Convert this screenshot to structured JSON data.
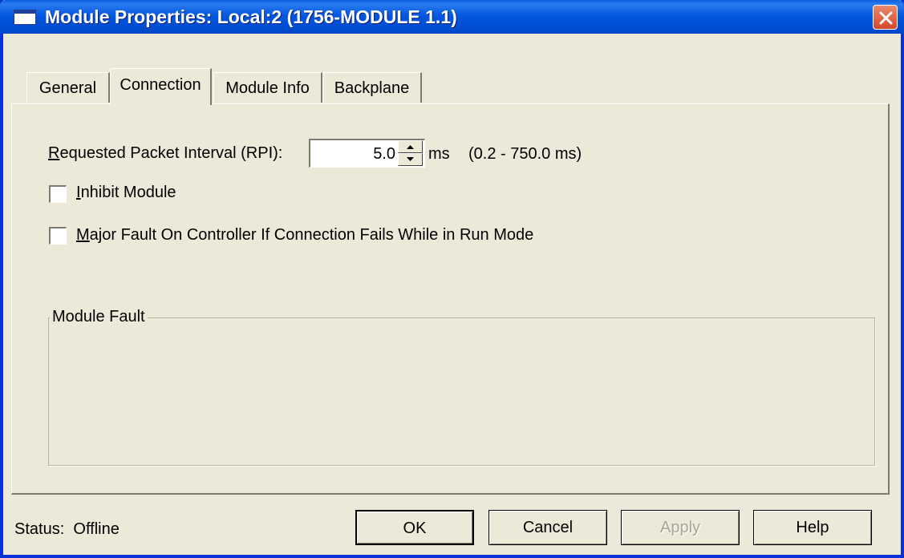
{
  "window": {
    "title": "Module Properties: Local:2 (1756-MODULE 1.1)"
  },
  "tabs": [
    {
      "label": "General",
      "active": false
    },
    {
      "label": "Connection",
      "active": true
    },
    {
      "label": "Module Info",
      "active": false
    },
    {
      "label": "Backplane",
      "active": false
    }
  ],
  "connection": {
    "rpi": {
      "label_accel": "R",
      "label_rest": "equested Packet Interval (RPI):",
      "value": "5.0",
      "unit": "ms",
      "range": "(0.2 - 750.0 ms)"
    },
    "inhibit": {
      "accel": "I",
      "rest": "nhibit Module",
      "checked": false
    },
    "major_fault": {
      "accel": "M",
      "rest": "ajor Fault On Controller If Connection Fails While in Run Mode",
      "checked": false
    },
    "module_fault": {
      "label": "Module Fault",
      "text": ""
    }
  },
  "footer": {
    "status_label": "Status:",
    "status_value": "Offline"
  },
  "buttons": {
    "ok": "OK",
    "cancel": "Cancel",
    "apply": "Apply",
    "help": "Help"
  },
  "colors": {
    "titlebar": "#0054e3",
    "dialog_bg": "#ece9d8",
    "close_button": "#d5462a",
    "disabled_text": "#a7a594"
  },
  "icons": {
    "window": "window-icon",
    "close": "close-icon",
    "spin_up": "up-arrow-icon",
    "spin_down": "down-arrow-icon"
  }
}
